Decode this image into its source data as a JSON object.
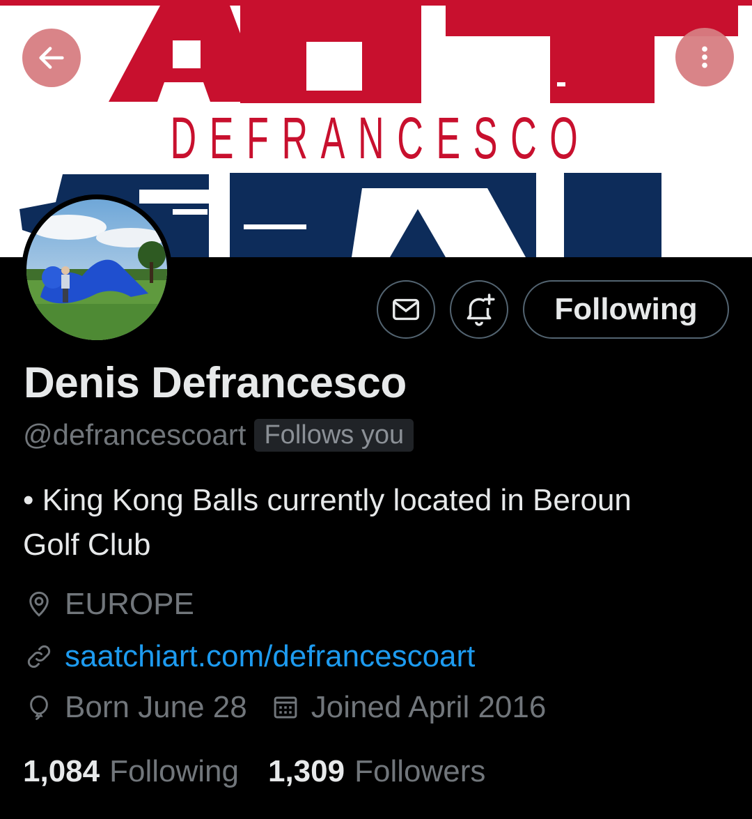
{
  "banner": {
    "text": "DEFRANCESCO",
    "colors": {
      "red": "#c8102e",
      "navy": "#0d2c5a"
    }
  },
  "nav": {
    "back_icon": "arrow-left-icon",
    "more_icon": "more-vertical-icon"
  },
  "actions": {
    "message_icon": "envelope-icon",
    "notify_icon": "bell-plus-icon",
    "following_label": "Following"
  },
  "profile": {
    "name": "Denis Defrancesco",
    "handle": "@defrancescoart",
    "follows_you": "Follows you",
    "bio_line1": "• King Kong Balls currently located in Beroun",
    "bio_line2": "Golf Club",
    "location": "EUROPE",
    "website": "saatchiart.com/defrancescoart",
    "birthday": "Born June 28",
    "joined": "Joined April 2016"
  },
  "stats": {
    "following_count": "1,084",
    "following_label": "Following",
    "followers_count": "1,309",
    "followers_label": "Followers"
  },
  "colors": {
    "background": "#000000",
    "text_primary": "#e7e9ea",
    "text_secondary": "#71767b",
    "link": "#1d9bf0",
    "border": "#536471"
  }
}
